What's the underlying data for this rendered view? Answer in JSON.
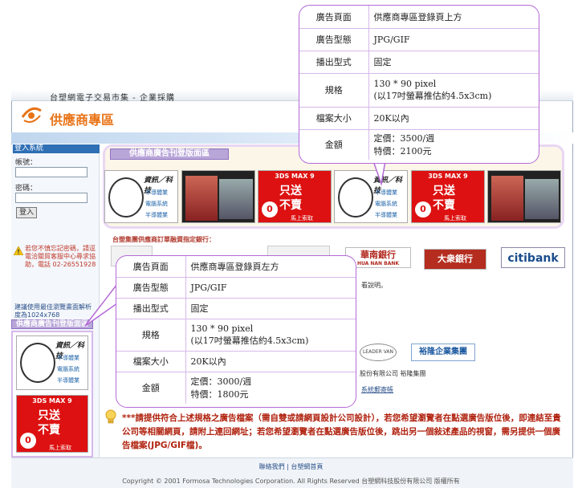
{
  "site": {
    "topbar_title": "台塑網電子交易市集 - 企業採購",
    "logo_title": "供應商專區"
  },
  "login": {
    "header": "登入系統",
    "account_label": "帳號：",
    "password_label": "密碼：",
    "login_button": "登入",
    "warning": "若您不慎忘記密碼，請逕電洽關貿客服中心尋求協助，電話 02-26551928",
    "browser_note": "建議使用最佳瀏覽畫面解析度為1024x768"
  },
  "promo": {
    "banner_label": "供應商廣告刊登版面區",
    "left_label": "供應商廣告刊登版面區",
    "ad_news": {
      "title": "資訊／科技",
      "lines": [
        "半導體業",
        "電腦系統",
        "半導體業"
      ]
    },
    "ad_sale": {
      "header": "3DS MAX 9",
      "big": "只送不賣",
      "zero": "0",
      "footer": "馬上索取"
    }
  },
  "banks": {
    "heading": "台塑集團供應商訂單融資指定銀行：",
    "huanan": "華南銀行",
    "huanan_en": "HUA NAN BANK",
    "dazhong": "大衆銀行",
    "citibank": "citibank"
  },
  "fragments": {
    "desc": "看說明。",
    "company": "股份有限公司 裕隆集團",
    "email": "系統郵寄帳",
    "yulon": "裕隆企業集團",
    "ldv": "LEADER VAN"
  },
  "callout_top": {
    "rows": [
      {
        "key": "廣告頁面",
        "value": "供應商專區登錄頁上方"
      },
      {
        "key": "廣告型態",
        "value": "JPG/GIF"
      },
      {
        "key": "播出型式",
        "value": "固定"
      },
      {
        "key": "規格",
        "value": "130 * 90 pixel",
        "value2": "(以17吋螢幕推估約4.5x3cm)"
      },
      {
        "key": "檔案大小",
        "value": "20K以內"
      },
      {
        "key": "金額",
        "value": "定價：3500/週",
        "value2": "特價：2100元"
      }
    ]
  },
  "callout_left": {
    "rows": [
      {
        "key": "廣告頁面",
        "value": "供應商專區登錄頁左方"
      },
      {
        "key": "廣告型態",
        "value": "JPG/GIF"
      },
      {
        "key": "播出型式",
        "value": "固定"
      },
      {
        "key": "規格",
        "value": "130 * 90 pixel",
        "value2": "(以17吋螢幕推估約4.5x3cm)"
      },
      {
        "key": "檔案大小",
        "value": "20K以內"
      },
      {
        "key": "金額",
        "value": "定價：3000/週",
        "value2": "特價：1800元"
      }
    ]
  },
  "notice": "***請提供符合上述規格之廣告檔案（需自雙或請網頁設計公司設計），若您希望瀏覽者在點選廣告版位後，即連結至貴公司等相關網頁，請附上連回網址；若您希望瀏覽者在點選廣告版位後，跳出另一個敍述產品的視窗，需另提供一個廣告檔案(JPG/GIF檔)。",
  "footer": {
    "links": "聯絡我們 | 台塑網首頁",
    "copyright": "Copyright © 2001 Formosa Technologies Corporation. All Rights Reserved 台塑網科技股份有限公司 版權所有"
  },
  "colors": {
    "accent_purple": "#b36ad8",
    "logo_orange": "#e87316",
    "notice_red": "#b0220f"
  }
}
